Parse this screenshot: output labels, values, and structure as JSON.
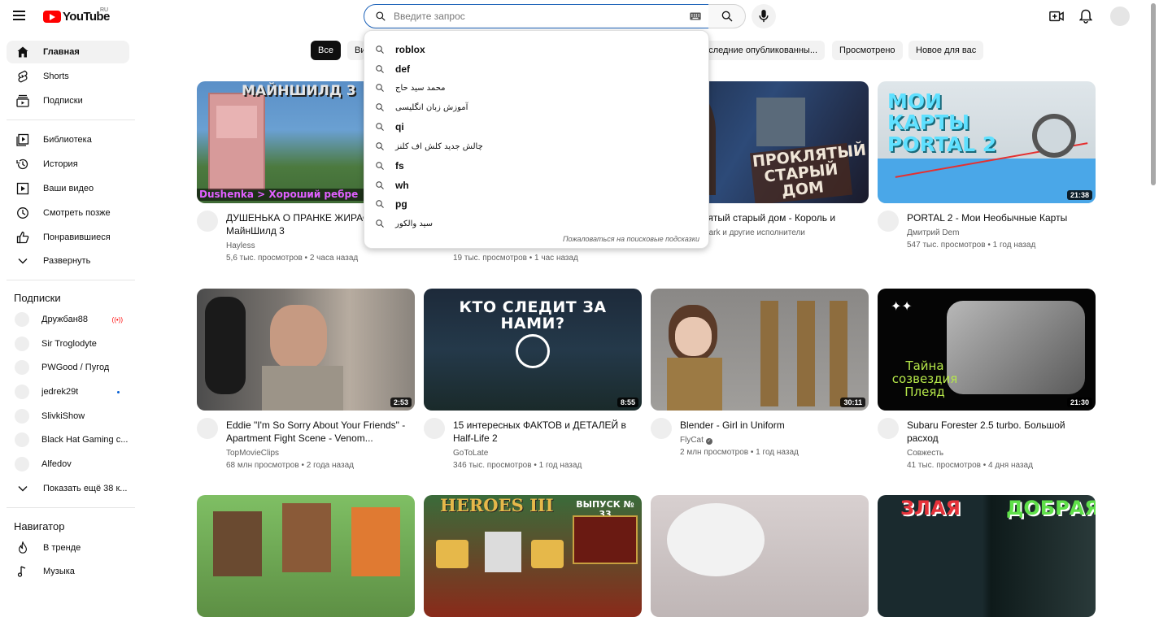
{
  "header": {
    "logo_text": "YouTube",
    "logo_region": "RU",
    "search_placeholder": "Введите запрос"
  },
  "search_suggestions": {
    "items": [
      "roblox",
      "def",
      "محمد سید حاج",
      "آموزش زبان انگلیسی",
      "qi",
      "چالش جدید کلش اف کلنز",
      "fs",
      "wh",
      "pg",
      "سید والکور"
    ],
    "report": "Пожаловаться на поисковые подсказки"
  },
  "sidebar": {
    "main": [
      {
        "label": "Главная",
        "icon": "home-icon"
      },
      {
        "label": "Shorts",
        "icon": "shorts-icon"
      },
      {
        "label": "Подписки",
        "icon": "subscriptions-icon"
      }
    ],
    "library": [
      {
        "label": "Библиотека",
        "icon": "library-icon"
      },
      {
        "label": "История",
        "icon": "history-icon"
      },
      {
        "label": "Ваши видео",
        "icon": "your-videos-icon"
      },
      {
        "label": "Смотреть позже",
        "icon": "watch-later-icon"
      },
      {
        "label": "Понравившиеся",
        "icon": "like-icon"
      },
      {
        "label": "Развернуть",
        "icon": "chevron-down-icon"
      }
    ],
    "subscriptions_title": "Подписки",
    "subscriptions": [
      {
        "label": "Дружбан88",
        "status": "live"
      },
      {
        "label": "Sir Troglodyte",
        "status": ""
      },
      {
        "label": "PWGood / Пугод",
        "status": ""
      },
      {
        "label": "jedrek29t",
        "status": "new"
      },
      {
        "label": "SlivkiShow",
        "status": ""
      },
      {
        "label": "Black Hat Gaming c...",
        "status": ""
      },
      {
        "label": "Alfedov",
        "status": ""
      },
      {
        "label": "Показать ещё 38 к...",
        "status": ""
      }
    ],
    "navigator_title": "Навигатор",
    "navigator": [
      {
        "label": "В тренде",
        "icon": "trending-icon"
      },
      {
        "label": "Музыка",
        "icon": "music-icon"
      }
    ]
  },
  "chips": [
    "Все",
    "Ви",
    "Последние опубликованны...",
    "Просмотрено",
    "Новое для вас"
  ],
  "videos": [
    {
      "title": "ДУШЕНЬКА О ПРАНКЕ ЖИРАФ | МайнШилд 3",
      "channel": "Hayless",
      "stats": "5,6 тыс. просмотров • 2 часа назад",
      "duration": "",
      "thumb_text": "МАЙНШИЛД 3",
      "thumb_sub": "Dushenka > Хороший ребре",
      "verified": false
    },
    {
      "title": "",
      "channel": "",
      "stats": "19 тыс. просмотров • 1 час назад",
      "duration": "",
      "thumb_text": "",
      "thumb_sub": "",
      "verified": false
    },
    {
      "title": "Проклятый старый дом - Король и",
      "channel": "Linkin Park и другие исполнители",
      "stats": "",
      "duration": "",
      "thumb_text": "ПРОКЛЯТЫЙ СТАРЫЙ ДОМ",
      "thumb_sub": "",
      "verified": false
    },
    {
      "title": "PORTAL 2 - Мои Необычные Карты",
      "channel": "Дмитрий Dem",
      "stats": "547 тыс. просмотров • 1 год назад",
      "duration": "21:38",
      "thumb_text": "МОИ КАРТЫ PORTAL 2",
      "thumb_sub": "",
      "verified": false
    },
    {
      "title": "Eddie \"I'm So Sorry About Your Friends\" - Apartment Fight Scene - Venom...",
      "channel": "TopMovieClips",
      "stats": "68 млн просмотров • 2 года назад",
      "duration": "2:53",
      "thumb_text": "",
      "thumb_sub": "",
      "verified": false
    },
    {
      "title": "15 интересных ФАКТОВ и ДЕТАЛЕЙ в Half-Life 2",
      "channel": "GoToLate",
      "stats": "346 тыс. просмотров • 1 год назад",
      "duration": "8:55",
      "thumb_text": "КТО СЛЕДИТ ЗА НАМИ?",
      "thumb_sub": "",
      "verified": false
    },
    {
      "title": "Blender - Girl in Uniform",
      "channel": "FlyCat",
      "stats": "2 млн просмотров • 1 год назад",
      "duration": "30:11",
      "thumb_text": "",
      "thumb_sub": "",
      "verified": true
    },
    {
      "title": "Subaru Forester 2.5 turbo. Большой расход",
      "channel": "Совжесть",
      "stats": "41 тыс. просмотров • 4 дня назад",
      "duration": "21:30",
      "thumb_text": "Тайна созвездия Плеяд",
      "thumb_sub": "",
      "verified": false
    },
    {
      "title": "",
      "channel": "",
      "stats": "",
      "duration": "",
      "thumb_text": "",
      "thumb_sub": "",
      "verified": false
    },
    {
      "title": "",
      "channel": "",
      "stats": "",
      "duration": "",
      "thumb_text": "HEROES III",
      "thumb_sub": "ВЫПУСК № 33",
      "verified": false
    },
    {
      "title": "",
      "channel": "",
      "stats": "",
      "duration": "",
      "thumb_text": "",
      "thumb_sub": "",
      "verified": false
    },
    {
      "title": "",
      "channel": "",
      "stats": "",
      "duration": "",
      "thumb_text": "ЗЛАЯ",
      "thumb_sub": "ДОБРАЯ",
      "verified": false
    }
  ],
  "colors": {
    "accent": "#ff0000",
    "search_border": "#1c62b9",
    "chip_active": "#0f0f0f"
  }
}
